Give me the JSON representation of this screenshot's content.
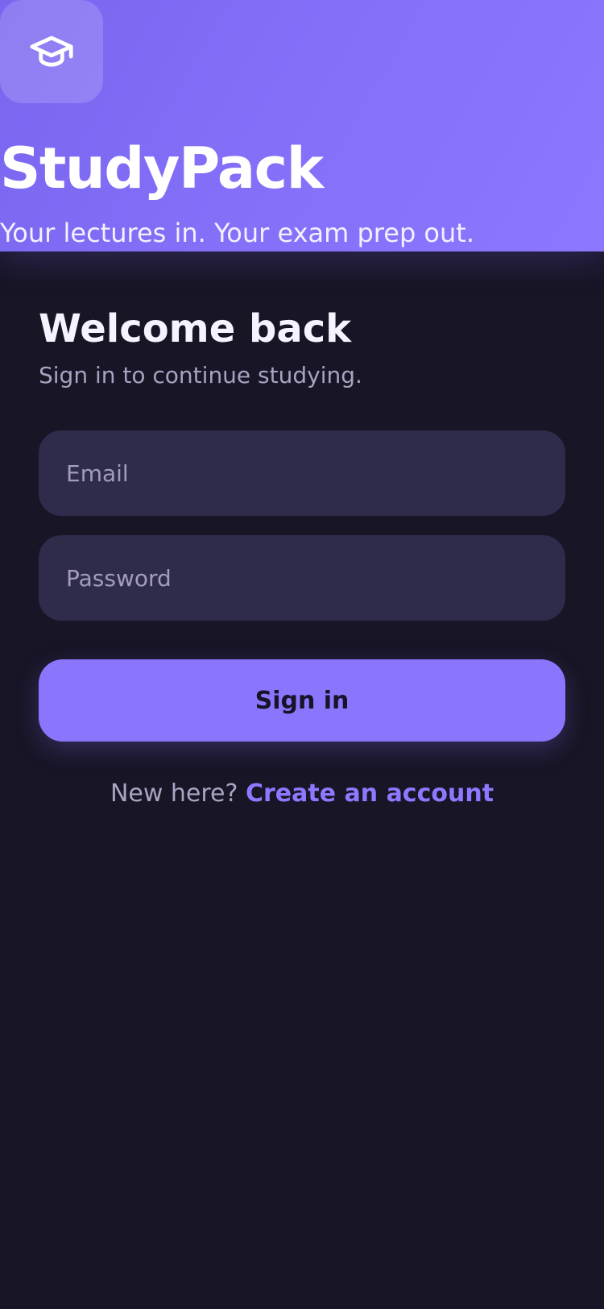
{
  "brand": {
    "logo_icon": "graduation-cap-icon",
    "name": "StudyPack",
    "tagline": "Your lectures in. Your exam prep out.",
    "accent": "#8a76fd"
  },
  "auth": {
    "title": "Welcome back",
    "subtitle": "Sign in to continue studying.",
    "email_placeholder": "Email",
    "email_value": "",
    "password_placeholder": "Password",
    "password_value": "",
    "submit_label": "Sign in",
    "signup_prompt": "New here?",
    "signup_link": "Create an account"
  }
}
